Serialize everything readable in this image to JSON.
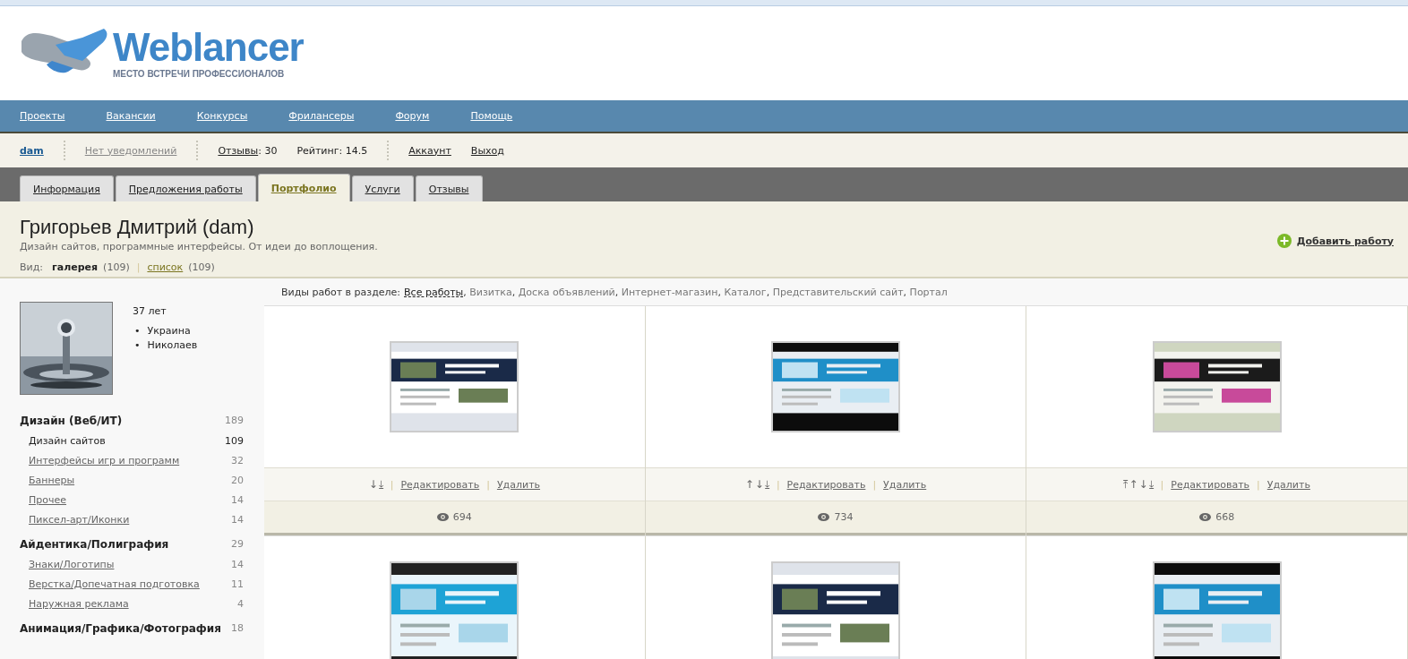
{
  "logo": {
    "name": "Weblancer",
    "tagline": "МЕСТО ВСТРЕЧИ ПРОФЕССИОНАЛОВ"
  },
  "nav": [
    "Проекты",
    "Вакансии",
    "Конкурсы",
    "Фрилансеры",
    "Форум",
    "Помощь"
  ],
  "userbar": {
    "username": "dam",
    "notifications": "Нет уведомлений",
    "reviews_label": "Отзывы",
    "reviews_count": ": 30",
    "rating": "Рейтинг: 14.5",
    "account": "Аккаунт",
    "logout": "Выход"
  },
  "tabs": [
    {
      "label": "Информация",
      "selected": false
    },
    {
      "label": "Предложения работы",
      "selected": false
    },
    {
      "label": "Портфолио",
      "selected": true
    },
    {
      "label": "Услуги",
      "selected": false
    },
    {
      "label": "Отзывы",
      "selected": false
    }
  ],
  "profile": {
    "name": "Григорьев Дмитрий (dam)",
    "description": "Дизайн сайтов, программные интерфейсы. От идеи до воплощения.",
    "view_label": "Вид:",
    "view_separator": "|",
    "views": [
      {
        "label": "галерея",
        "count": "(109)",
        "selected": true
      },
      {
        "label": "список",
        "count": "(109)",
        "selected": false
      }
    ],
    "add_button": "Добавить работу"
  },
  "sidebar": {
    "age": "37 лет",
    "bullet": "•",
    "locations": [
      "Украина",
      "Николаев"
    ],
    "categories": [
      {
        "name": "Дизайн (Веб/ИТ)",
        "count": "189",
        "children": [
          {
            "name": "Дизайн сайтов",
            "count": "109",
            "selected": true
          },
          {
            "name": "Интерфейсы игр и программ",
            "count": "32",
            "selected": false
          },
          {
            "name": "Баннеры",
            "count": "20",
            "selected": false
          },
          {
            "name": "Прочее",
            "count": "14",
            "selected": false
          },
          {
            "name": "Пиксел-арт/Иконки",
            "count": "14",
            "selected": false
          }
        ]
      },
      {
        "name": "Айдентика/Полиграфия",
        "count": "29",
        "children": [
          {
            "name": "Знаки/Логотипы",
            "count": "14",
            "selected": false
          },
          {
            "name": "Верстка/Допечатная подготовка",
            "count": "11",
            "selected": false
          },
          {
            "name": "Наружная реклама",
            "count": "4",
            "selected": false
          }
        ]
      },
      {
        "name": "Анимация/Графика/Фотография",
        "count": "18"
      }
    ]
  },
  "filter": {
    "label": "Виды работ в разделе:",
    "separator": ",",
    "items": [
      {
        "label": "Все работы",
        "selected": true
      },
      {
        "label": "Визитка",
        "selected": false
      },
      {
        "label": "Доска объявлений",
        "selected": false
      },
      {
        "label": "Интернет-магазин",
        "selected": false
      },
      {
        "label": "Каталог",
        "selected": false
      },
      {
        "label": "Представительский сайт",
        "selected": false
      },
      {
        "label": "Портал",
        "selected": false
      }
    ]
  },
  "action_separator": "|",
  "works": [
    {
      "kind": "picture",
      "moves": [
        "↓",
        "⤓"
      ],
      "edit": "Редактировать",
      "delete": "Удалить",
      "views": "694"
    },
    {
      "kind": "picture",
      "moves": [
        "↑",
        "↓",
        "⤓"
      ],
      "edit": "Редактировать",
      "delete": "Удалить",
      "views": "734"
    },
    {
      "kind": "picture",
      "moves": [
        "⤒",
        "↑",
        "↓",
        "⤓"
      ],
      "edit": "Редактировать",
      "delete": "Удалить",
      "views": "668"
    },
    {
      "kind": "picture"
    },
    {
      "kind": "picture"
    },
    {
      "kind": "picture"
    }
  ]
}
